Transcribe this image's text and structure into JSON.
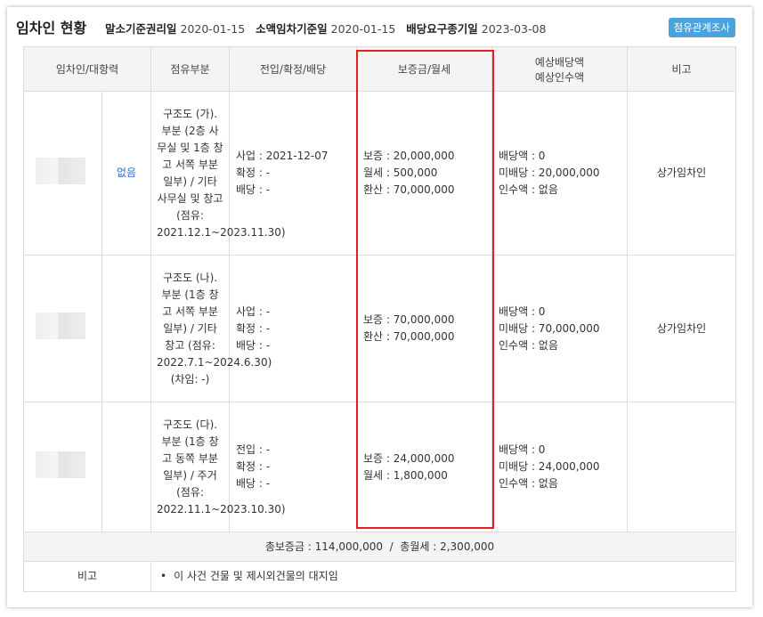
{
  "header": {
    "title": "임차인 현황",
    "fields": [
      {
        "label": "말소기준권리일",
        "value": "2020-01-15"
      },
      {
        "label": "소액임차기준일",
        "value": "2020-01-15"
      },
      {
        "label": "배당요구종기일",
        "value": "2023-03-08"
      }
    ],
    "button": "점유관계조사"
  },
  "columns": [
    "임차인/대항력",
    "점유부분",
    "전입/확정/배당",
    "보증금/월세",
    "예상배당액",
    "예상인수액",
    "비고"
  ],
  "rows": [
    {
      "daehang": "없음",
      "occupancy": "구조도 (가). 부분 (2층 사무실 및 1층 창고 서쪽 부분 일부) / 기타 사무실 및 창고 (점유: 2021.12.1~2023.11.30)",
      "move": [
        "사업 : 2021-12-07",
        "확정 : -",
        "배당 : -"
      ],
      "deposit": [
        "보증 : 20,000,000",
        "월세 : 500,000",
        "환산 : 70,000,000"
      ],
      "expected": [
        "배당액 : 0",
        "미배당 : 20,000,000",
        "인수액 : 없음"
      ],
      "note": "상가임차인"
    },
    {
      "daehang": "",
      "occupancy": "구조도 (나). 부분 (1층 창고 서쪽 부분 일부) / 기타 창고 (점유: 2022.7.1~2024.6.30)(차임: -)",
      "move": [
        "사업 : -",
        "확정 : -",
        "배당 : -"
      ],
      "deposit": [
        "보증 : 70,000,000",
        "환산 : 70,000,000"
      ],
      "expected": [
        "배당액 : 0",
        "미배당 : 70,000,000",
        "인수액 : 없음"
      ],
      "note": "상가임차인"
    },
    {
      "daehang": "",
      "occupancy": "구조도 (다). 부분 (1층 창고 동쪽 부분 일부) / 주거 (점유: 2022.11.1~2023.10.30)",
      "move": [
        "전입 : -",
        "확정 : -",
        "배당 : -"
      ],
      "deposit": [
        "보증 : 24,000,000",
        "월세 : 1,800,000"
      ],
      "expected": [
        "배당액 : 0",
        "미배당 : 24,000,000",
        "인수액 : 없음"
      ],
      "note": ""
    }
  ],
  "total": "총보증금 : 114,000,000  /  총월세 : 2,300,000",
  "remarks": {
    "label": "비고",
    "items": [
      "이 사건 건물 및 제시외건물의 대지임"
    ]
  },
  "colors": {
    "highlight_box": "#e02020",
    "button_bg": "#4aa3df",
    "link": "#2a6fd6"
  }
}
